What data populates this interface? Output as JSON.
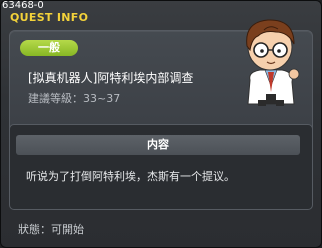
{
  "window": {
    "quest_id": "63468-0",
    "title": "QUEST INFO"
  },
  "quest": {
    "category_badge": "一般",
    "title": "[拟真机器人]阿特利埃内部调查",
    "level_requirement": "建議等級：33~37",
    "npc_portrait": "scientist-npc-portrait"
  },
  "content": {
    "header": "内容",
    "text": "听说为了打倒阿特利埃，杰斯有一个提议。"
  },
  "status": "狀態：可開始",
  "colors": {
    "title_yellow": "#f3d23a",
    "badge_green": "#9cc93a"
  }
}
